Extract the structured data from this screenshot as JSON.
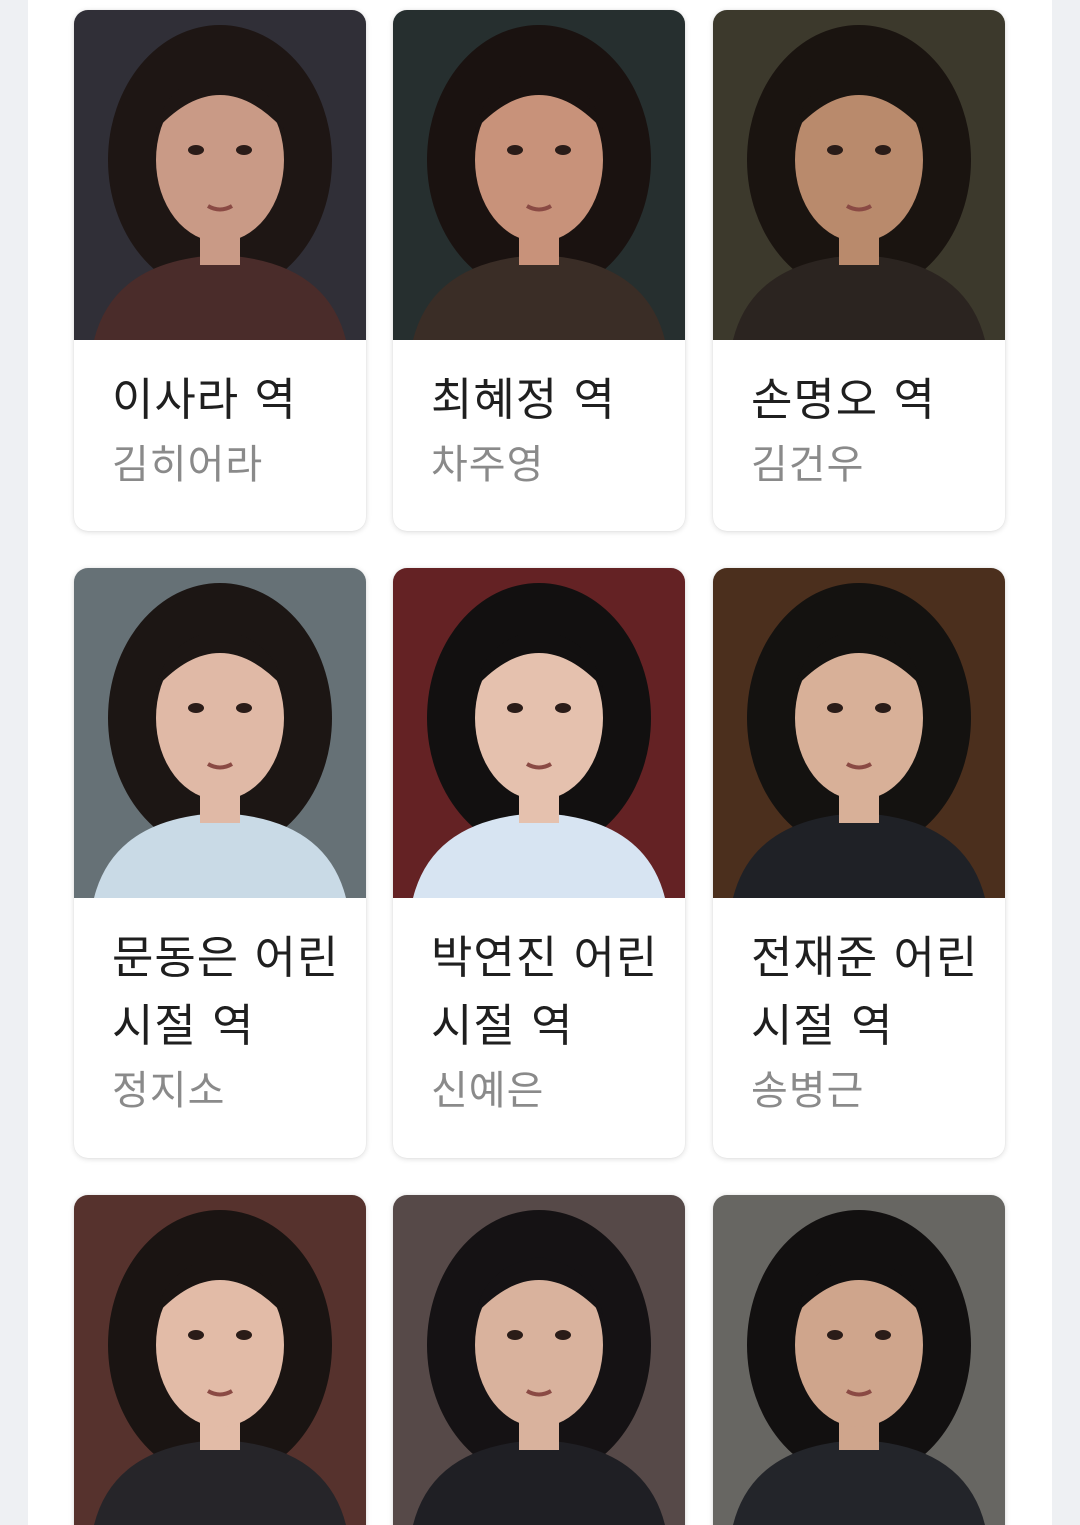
{
  "cast": [
    {
      "role": "이사라 역",
      "actor": "김히어라",
      "bg": "#3b3a44",
      "skin": "#c99a86",
      "hair": "#1e1614",
      "top": "#4a2c2a"
    },
    {
      "role": "최혜정 역",
      "actor": "차주영",
      "bg": "#2f3a3a",
      "skin": "#c8927a",
      "hair": "#1a1210",
      "top": "#3a2d26"
    },
    {
      "role": "손명오 역",
      "actor": "김건우",
      "bg": "#4a4636",
      "skin": "#b98a6c",
      "hair": "#1a1410",
      "top": "#2b2420"
    },
    {
      "role": "문동은 어린 시절 역",
      "actor": "정지소",
      "bg": "#7d8a90",
      "skin": "#e0b9a6",
      "hair": "#1c1614",
      "top": "#c9dae6"
    },
    {
      "role": "박연진 어린 시절 역",
      "actor": "신예은",
      "bg": "#7a2a2c",
      "skin": "#e5c1ae",
      "hair": "#121010",
      "top": "#d7e4f2"
    },
    {
      "role": "전재준 어린 시절 역",
      "actor": "송병근",
      "bg": "#5c3a24",
      "skin": "#d8b098",
      "hair": "#141210",
      "top": "#1f2126"
    },
    {
      "role": "",
      "actor": "",
      "bg": "#6a3e38",
      "skin": "#e2bba7",
      "hair": "#1a1412",
      "top": "#262529"
    },
    {
      "role": "",
      "actor": "",
      "bg": "#6a5a58",
      "skin": "#d9b29d",
      "hair": "#151214",
      "top": "#1f1f24"
    },
    {
      "role": "",
      "actor": "",
      "bg": "#7e7d78",
      "skin": "#cfa58c",
      "hair": "#121010",
      "top": "#23252a"
    }
  ]
}
